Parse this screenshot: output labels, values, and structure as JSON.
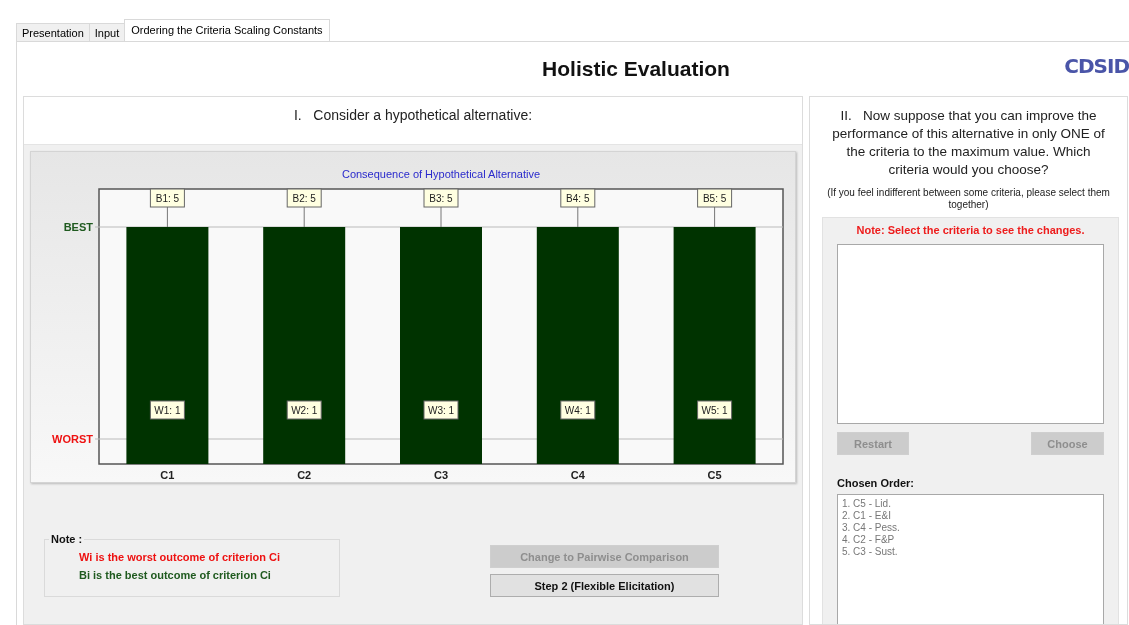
{
  "tabs": [
    {
      "label": "Presentation",
      "selected": false
    },
    {
      "label": "Input",
      "selected": false
    },
    {
      "label": "Ordering the Criteria Scaling Constants",
      "selected": true
    }
  ],
  "title": "Holistic Evaluation",
  "logo": {
    "text": "CDSID"
  },
  "left_panel": {
    "heading": "I.   Consider a hypothetical alternative:",
    "chart": {
      "title": "Consequence of Hypothetical Alternative",
      "best_label": "BEST",
      "worst_label": "WORST",
      "bars": [
        {
          "category": "C1",
          "best": "B1: 5",
          "worst": "W1: 1"
        },
        {
          "category": "C2",
          "best": "B2: 5",
          "worst": "W2: 1"
        },
        {
          "category": "C3",
          "best": "B3: 5",
          "worst": "W3: 1"
        },
        {
          "category": "C4",
          "best": "B4: 5",
          "worst": "W4: 1"
        },
        {
          "category": "C5",
          "best": "B5: 5",
          "worst": "W5: 1"
        }
      ]
    },
    "note": {
      "label": "Note :",
      "lines": [
        {
          "kind": "worst",
          "text": "Wi is the worst outcome of criterion Ci"
        },
        {
          "kind": "best",
          "text": "Bi is the best outcome of criterion Ci"
        }
      ]
    },
    "buttons": [
      {
        "label": "Change to Pairwise Comparison",
        "disabled": true
      },
      {
        "label": "Step 2 (Flexible Elicitation)",
        "disabled": false
      }
    ]
  },
  "right_panel": {
    "question": "II.   Now suppose that you can improve the performance of this alternative in only ONE of the criteria to the maximum value. Which criteria would you choose?",
    "hint": "(If you feel indifferent between some criteria, please select them together)",
    "note": "Note: Select the criteria to see the changes.",
    "buttons": [
      {
        "label": "Restart",
        "disabled": true
      },
      {
        "label": "Choose",
        "disabled": true
      }
    ],
    "chosen_label": "Chosen Order:",
    "chosen_order": [
      "1. C5 - Lid.",
      "2. C1 - E&I",
      "3. C4 - Pess.",
      "4. C2 - F&P",
      "5. C3 - Sust."
    ]
  }
}
